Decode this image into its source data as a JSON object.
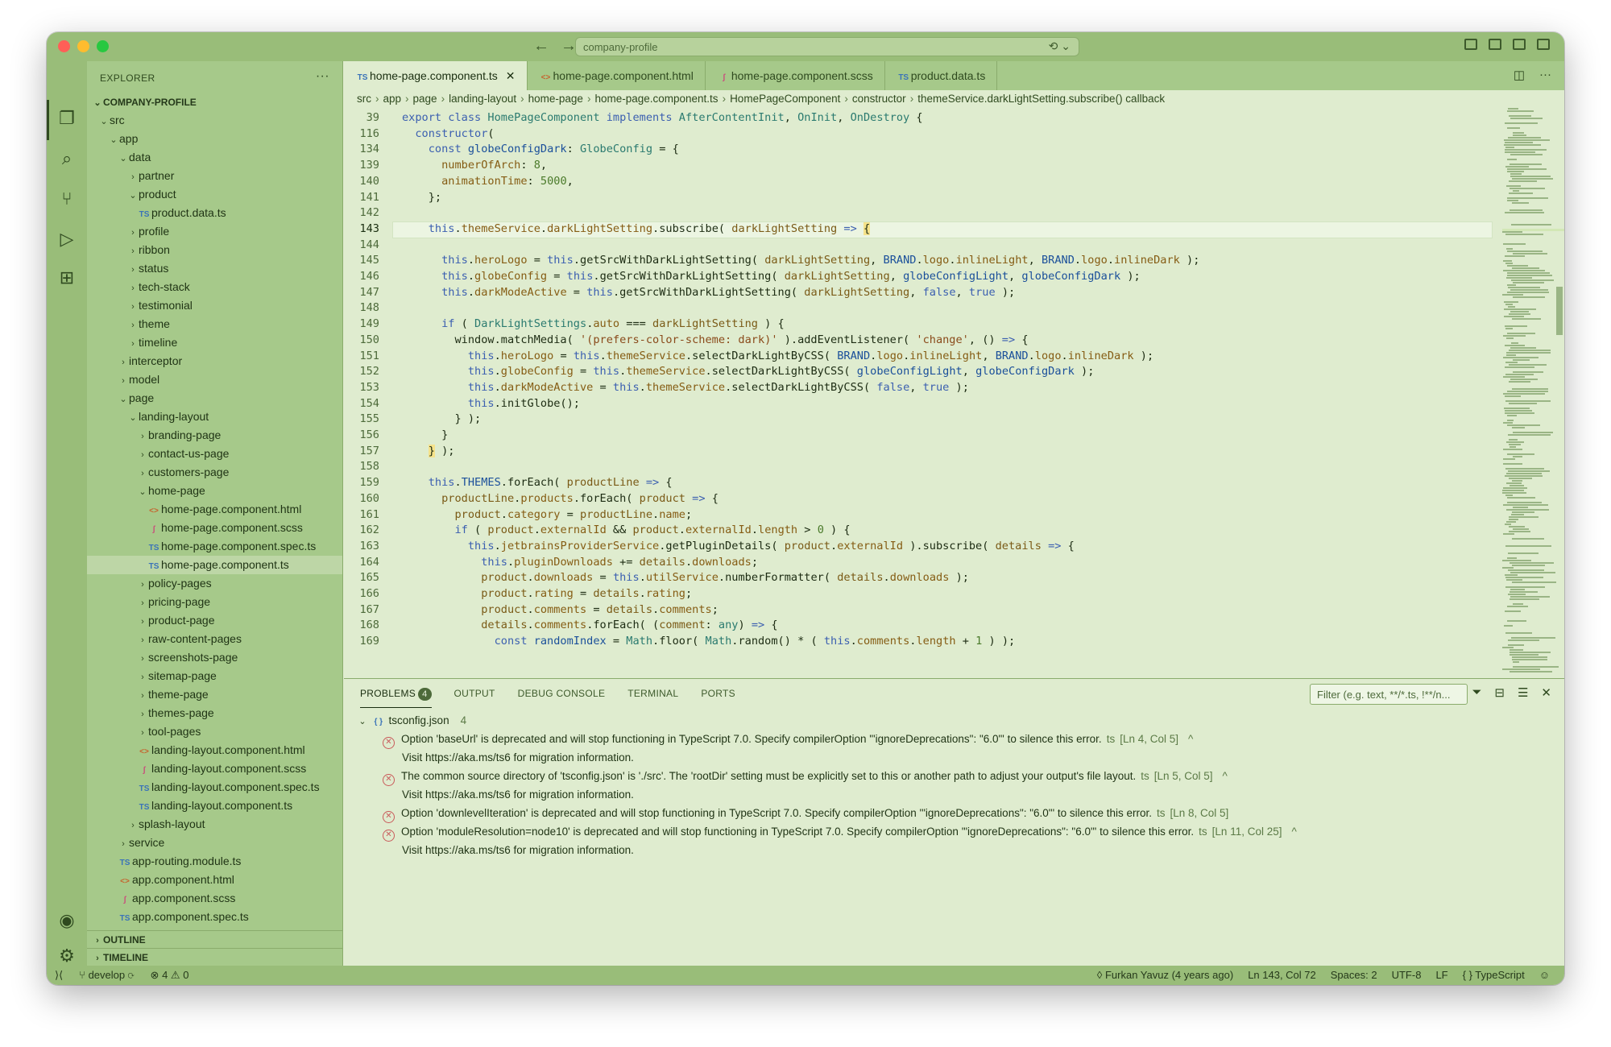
{
  "window": {
    "title": "company-profile",
    "traffic": [
      "#ff5f57",
      "#febc2e",
      "#28c840"
    ]
  },
  "explorer": {
    "header": "EXPLORER",
    "project": "COMPANY-PROFILE",
    "items": [
      {
        "label": "src",
        "depth": 0,
        "type": "folder-open"
      },
      {
        "label": "app",
        "depth": 1,
        "type": "folder-open"
      },
      {
        "label": "data",
        "depth": 2,
        "type": "folder-open"
      },
      {
        "label": "partner",
        "depth": 3,
        "type": "folder"
      },
      {
        "label": "product",
        "depth": 3,
        "type": "folder-open"
      },
      {
        "label": "product.data.ts",
        "depth": 4,
        "type": "ts"
      },
      {
        "label": "profile",
        "depth": 3,
        "type": "folder"
      },
      {
        "label": "ribbon",
        "depth": 3,
        "type": "folder"
      },
      {
        "label": "status",
        "depth": 3,
        "type": "folder"
      },
      {
        "label": "tech-stack",
        "depth": 3,
        "type": "folder"
      },
      {
        "label": "testimonial",
        "depth": 3,
        "type": "folder"
      },
      {
        "label": "theme",
        "depth": 3,
        "type": "folder"
      },
      {
        "label": "timeline",
        "depth": 3,
        "type": "folder"
      },
      {
        "label": "interceptor",
        "depth": 2,
        "type": "folder"
      },
      {
        "label": "model",
        "depth": 2,
        "type": "folder"
      },
      {
        "label": "page",
        "depth": 2,
        "type": "folder-open"
      },
      {
        "label": "landing-layout",
        "depth": 3,
        "type": "folder-open"
      },
      {
        "label": "branding-page",
        "depth": 4,
        "type": "folder"
      },
      {
        "label": "contact-us-page",
        "depth": 4,
        "type": "folder"
      },
      {
        "label": "customers-page",
        "depth": 4,
        "type": "folder"
      },
      {
        "label": "home-page",
        "depth": 4,
        "type": "folder-open"
      },
      {
        "label": "home-page.component.html",
        "depth": 5,
        "type": "html"
      },
      {
        "label": "home-page.component.scss",
        "depth": 5,
        "type": "scss"
      },
      {
        "label": "home-page.component.spec.ts",
        "depth": 5,
        "type": "ts"
      },
      {
        "label": "home-page.component.ts",
        "depth": 5,
        "type": "ts",
        "selected": true
      },
      {
        "label": "policy-pages",
        "depth": 4,
        "type": "folder"
      },
      {
        "label": "pricing-page",
        "depth": 4,
        "type": "folder"
      },
      {
        "label": "product-page",
        "depth": 4,
        "type": "folder"
      },
      {
        "label": "raw-content-pages",
        "depth": 4,
        "type": "folder"
      },
      {
        "label": "screenshots-page",
        "depth": 4,
        "type": "folder"
      },
      {
        "label": "sitemap-page",
        "depth": 4,
        "type": "folder"
      },
      {
        "label": "theme-page",
        "depth": 4,
        "type": "folder"
      },
      {
        "label": "themes-page",
        "depth": 4,
        "type": "folder"
      },
      {
        "label": "tool-pages",
        "depth": 4,
        "type": "folder"
      },
      {
        "label": "landing-layout.component.html",
        "depth": 4,
        "type": "html"
      },
      {
        "label": "landing-layout.component.scss",
        "depth": 4,
        "type": "scss"
      },
      {
        "label": "landing-layout.component.spec.ts",
        "depth": 4,
        "type": "ts"
      },
      {
        "label": "landing-layout.component.ts",
        "depth": 4,
        "type": "ts"
      },
      {
        "label": "splash-layout",
        "depth": 3,
        "type": "folder"
      },
      {
        "label": "service",
        "depth": 2,
        "type": "folder"
      },
      {
        "label": "app-routing.module.ts",
        "depth": 2,
        "type": "ts"
      },
      {
        "label": "app.component.html",
        "depth": 2,
        "type": "html"
      },
      {
        "label": "app.component.scss",
        "depth": 2,
        "type": "scss"
      },
      {
        "label": "app.component.spec.ts",
        "depth": 2,
        "type": "ts"
      }
    ],
    "outline": "OUTLINE",
    "timeline": "TIMELINE"
  },
  "tabs": [
    {
      "label": "home-page.component.ts",
      "type": "ts",
      "active": true
    },
    {
      "label": "home-page.component.html",
      "type": "html"
    },
    {
      "label": "home-page.component.scss",
      "type": "scss"
    },
    {
      "label": "product.data.ts",
      "type": "ts"
    }
  ],
  "breadcrumbs": [
    "src",
    "app",
    "page",
    "landing-layout",
    "home-page",
    "home-page.component.ts",
    "HomePageComponent",
    "constructor",
    "themeService.darkLightSetting.subscribe() callback"
  ],
  "cursor_line": "143",
  "code": [
    {
      "n": "39",
      "html": "<span class='kw'>export class</span> <span class='ty'>HomePageComponent</span> <span class='kw'>implements</span> <span class='ty'>AfterContentInit</span>, <span class='ty'>OnInit</span>, <span class='ty'>OnDestroy</span> {"
    },
    {
      "n": "116",
      "html": "  <span class='kw'>constructor</span>("
    },
    {
      "n": "134",
      "html": "    <span class='kw'>const</span> <span class='bl'>globeConfigDark</span>: <span class='ty'>GlobeConfig</span> = {"
    },
    {
      "n": "139",
      "html": "      <span class='pr'>numberOfArch</span>: <span class='nu'>8</span>,"
    },
    {
      "n": "140",
      "html": "      <span class='pr'>animationTime</span>: <span class='nu'>5000</span>,"
    },
    {
      "n": "141",
      "html": "    };"
    },
    {
      "n": "142",
      "html": ""
    },
    {
      "n": "143",
      "html": "    <span class='kw'>this</span>.<span class='pr'>themeService</span>.<span class='pr'>darkLightSetting</span>.subscribe( <span class='va'>darkLightSetting</span> <span class='kw'>=&gt;</span> <span class='brk'>{</span>"
    },
    {
      "n": "144",
      "html": ""
    },
    {
      "n": "145",
      "html": "      <span class='kw'>this</span>.<span class='pr'>heroLogo</span> = <span class='kw'>this</span>.getSrcWithDarkLightSetting( <span class='va'>darkLightSetting</span>, <span class='bl'>BRAND</span>.<span class='pr'>logo</span>.<span class='pr'>inlineLight</span>, <span class='bl'>BRAND</span>.<span class='pr'>logo</span>.<span class='pr'>inlineDark</span> );"
    },
    {
      "n": "146",
      "html": "      <span class='kw'>this</span>.<span class='pr'>globeConfig</span> = <span class='kw'>this</span>.getSrcWithDarkLightSetting( <span class='va'>darkLightSetting</span>, <span class='bl'>globeConfigLight</span>, <span class='bl'>globeConfigDark</span> );"
    },
    {
      "n": "147",
      "html": "      <span class='kw'>this</span>.<span class='pr'>darkModeActive</span> = <span class='kw'>this</span>.getSrcWithDarkLightSetting( <span class='va'>darkLightSetting</span>, <span class='kw'>false</span>, <span class='kw'>true</span> );"
    },
    {
      "n": "148",
      "html": ""
    },
    {
      "n": "149",
      "html": "      <span class='kw'>if</span> ( <span class='ty'>DarkLightSettings</span>.<span class='pr'>auto</span> === <span class='va'>darkLightSetting</span> ) {"
    },
    {
      "n": "150",
      "html": "        window.matchMedia( <span class='st'>'(prefers-color-scheme: dark)'</span> ).addEventListener( <span class='st'>'change'</span>, () <span class='kw'>=&gt;</span> {"
    },
    {
      "n": "151",
      "html": "          <span class='kw'>this</span>.<span class='pr'>heroLogo</span> = <span class='kw'>this</span>.<span class='pr'>themeService</span>.selectDarkLightByCSS( <span class='bl'>BRAND</span>.<span class='pr'>logo</span>.<span class='pr'>inlineLight</span>, <span class='bl'>BRAND</span>.<span class='pr'>logo</span>.<span class='pr'>inlineDark</span> );"
    },
    {
      "n": "152",
      "html": "          <span class='kw'>this</span>.<span class='pr'>globeConfig</span> = <span class='kw'>this</span>.<span class='pr'>themeService</span>.selectDarkLightByCSS( <span class='bl'>globeConfigLight</span>, <span class='bl'>globeConfigDark</span> );"
    },
    {
      "n": "153",
      "html": "          <span class='kw'>this</span>.<span class='pr'>darkModeActive</span> = <span class='kw'>this</span>.<span class='pr'>themeService</span>.selectDarkLightByCSS( <span class='kw'>false</span>, <span class='kw'>true</span> );"
    },
    {
      "n": "154",
      "html": "          <span class='kw'>this</span>.initGlobe();"
    },
    {
      "n": "155",
      "html": "        } );"
    },
    {
      "n": "156",
      "html": "      }"
    },
    {
      "n": "157",
      "html": "    <span class='brk'>}</span> );"
    },
    {
      "n": "158",
      "html": ""
    },
    {
      "n": "159",
      "html": "    <span class='kw'>this</span>.<span class='bl'>THEMES</span>.forEach( <span class='va'>productLine</span> <span class='kw'>=&gt;</span> {"
    },
    {
      "n": "160",
      "html": "      <span class='va'>productLine</span>.<span class='pr'>products</span>.forEach( <span class='va'>product</span> <span class='kw'>=&gt;</span> {"
    },
    {
      "n": "161",
      "html": "        <span class='va'>product</span>.<span class='pr'>category</span> = <span class='va'>productLine</span>.<span class='pr'>name</span>;"
    },
    {
      "n": "162",
      "html": "        <span class='kw'>if</span> ( <span class='va'>product</span>.<span class='pr'>externalId</span> &amp;&amp; <span class='va'>product</span>.<span class='pr'>externalId</span>.<span class='pr'>length</span> &gt; <span class='nu'>0</span> ) {"
    },
    {
      "n": "163",
      "html": "          <span class='kw'>this</span>.<span class='pr'>jetbrainsProviderService</span>.getPluginDetails( <span class='va'>product</span>.<span class='pr'>externalId</span> ).subscribe( <span class='va'>details</span> <span class='kw'>=&gt;</span> {"
    },
    {
      "n": "164",
      "html": "            <span class='kw'>this</span>.<span class='pr'>pluginDownloads</span> += <span class='va'>details</span>.<span class='pr'>downloads</span>;"
    },
    {
      "n": "165",
      "html": "            <span class='va'>product</span>.<span class='pr'>downloads</span> = <span class='kw'>this</span>.<span class='pr'>utilService</span>.numberFormatter( <span class='va'>details</span>.<span class='pr'>downloads</span> );"
    },
    {
      "n": "166",
      "html": "            <span class='va'>product</span>.<span class='pr'>rating</span> = <span class='va'>details</span>.<span class='pr'>rating</span>;"
    },
    {
      "n": "167",
      "html": "            <span class='va'>product</span>.<span class='pr'>comments</span> = <span class='va'>details</span>.<span class='pr'>comments</span>;"
    },
    {
      "n": "168",
      "html": "            <span class='va'>details</span>.<span class='pr'>comments</span>.forEach( (<span class='va'>comment</span>: <span class='ty'>any</span>) <span class='kw'>=&gt;</span> {"
    },
    {
      "n": "169",
      "html": "              <span class='kw'>const</span> <span class='bl'>randomIndex</span> = <span class='ty'>Math</span>.floor( <span class='ty'>Math</span>.random() * ( <span class='kw'>this</span>.<span class='pr'>comments</span>.<span class='pr'>length</span> + <span class='nu'>1</span> ) );"
    }
  ],
  "panel": {
    "tabs": [
      {
        "label": "PROBLEMS",
        "active": true,
        "badge": "4"
      },
      {
        "label": "OUTPUT"
      },
      {
        "label": "DEBUG CONSOLE"
      },
      {
        "label": "TERMINAL"
      },
      {
        "label": "PORTS"
      }
    ],
    "filter_placeholder": "Filter (e.g. text, **/*.ts, !**/n...",
    "group": {
      "file": "tsconfig.json",
      "count": "4"
    },
    "problems": [
      {
        "msg": "Option 'baseUrl' is deprecated and will stop functioning in TypeScript 7.0. Specify compilerOption '\"ignoreDeprecations\": \"6.0\"' to silence this error.",
        "src": "ts",
        "loc": "[Ln 4, Col 5]",
        "expanded": true,
        "detail": "Visit https://aka.ms/ts6 for migration information."
      },
      {
        "msg": "The common source directory of 'tsconfig.json' is './src'. The 'rootDir' setting must be explicitly set to this or another path to adjust your output's file layout.",
        "src": "ts",
        "loc": "[Ln 5, Col 5]",
        "expanded": true,
        "detail": "Visit https://aka.ms/ts6 for migration information."
      },
      {
        "msg": "Option 'downlevelIteration' is deprecated and will stop functioning in TypeScript 7.0. Specify compilerOption '\"ignoreDeprecations\": \"6.0\"' to silence this error.",
        "src": "ts",
        "loc": "[Ln 8, Col 5]",
        "expanded": false
      },
      {
        "msg": "Option 'moduleResolution=node10' is deprecated and will stop functioning in TypeScript 7.0. Specify compilerOption '\"ignoreDeprecations\": \"6.0\"' to silence this error.",
        "src": "ts",
        "loc": "[Ln 11, Col 25]",
        "expanded": true,
        "detail": "Visit https://aka.ms/ts6 for migration information."
      }
    ]
  },
  "status": {
    "branch": "develop",
    "errors": "4",
    "warnings": "0",
    "blame": "Furkan Yavuz (4 years ago)",
    "position": "Ln 143, Col 72",
    "spaces": "Spaces: 2",
    "encoding": "UTF-8",
    "eol": "LF",
    "language": "TypeScript"
  },
  "icons": {
    "explorer": "files-icon",
    "search": "search-icon",
    "scm": "source-control-icon",
    "debug": "run-debug-icon",
    "extensions": "extensions-icon",
    "account": "account-icon",
    "settings": "gear-icon"
  }
}
